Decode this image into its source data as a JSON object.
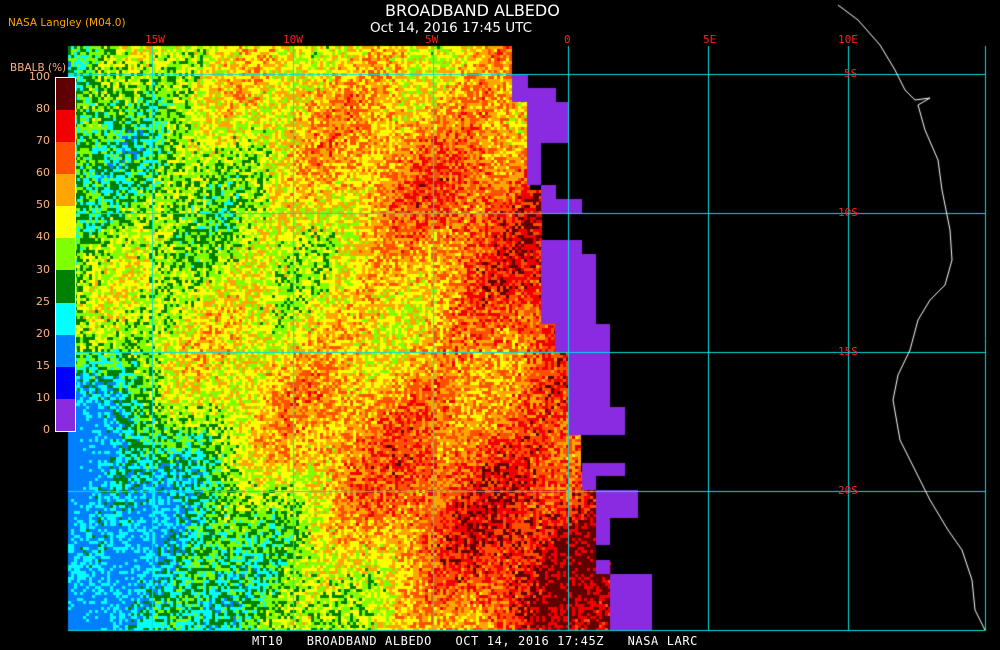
{
  "header": {
    "title": "BROADBAND ALBEDO",
    "subtitle": "Oct 14, 2016 17:45 UTC",
    "credit": "NASA Langley (M04.0)"
  },
  "colorbar": {
    "title": "BBALB (%)",
    "labels": [
      "100",
      "80",
      "70",
      "60",
      "50",
      "40",
      "30",
      "25",
      "20",
      "15",
      "10",
      "0"
    ],
    "colors": [
      "#600000",
      "#f00000",
      "#ff5000",
      "#ffa500",
      "#ffff00",
      "#80ff00",
      "#008000",
      "#00ffff",
      "#0080ff",
      "#0000ff",
      "#8a2be2"
    ]
  },
  "axes": {
    "lon_labels": [
      "15W",
      "10W",
      "5W",
      "0",
      "5E",
      "10E"
    ],
    "lat_labels": [
      "5S",
      "10S",
      "15S",
      "20S"
    ],
    "grid_color": "#00e0e0",
    "label_color": "#ff2020"
  },
  "footer": "MT10   BROADBAND ALBEDO   OCT 14, 2016 17:45Z   NASA LARC"
}
